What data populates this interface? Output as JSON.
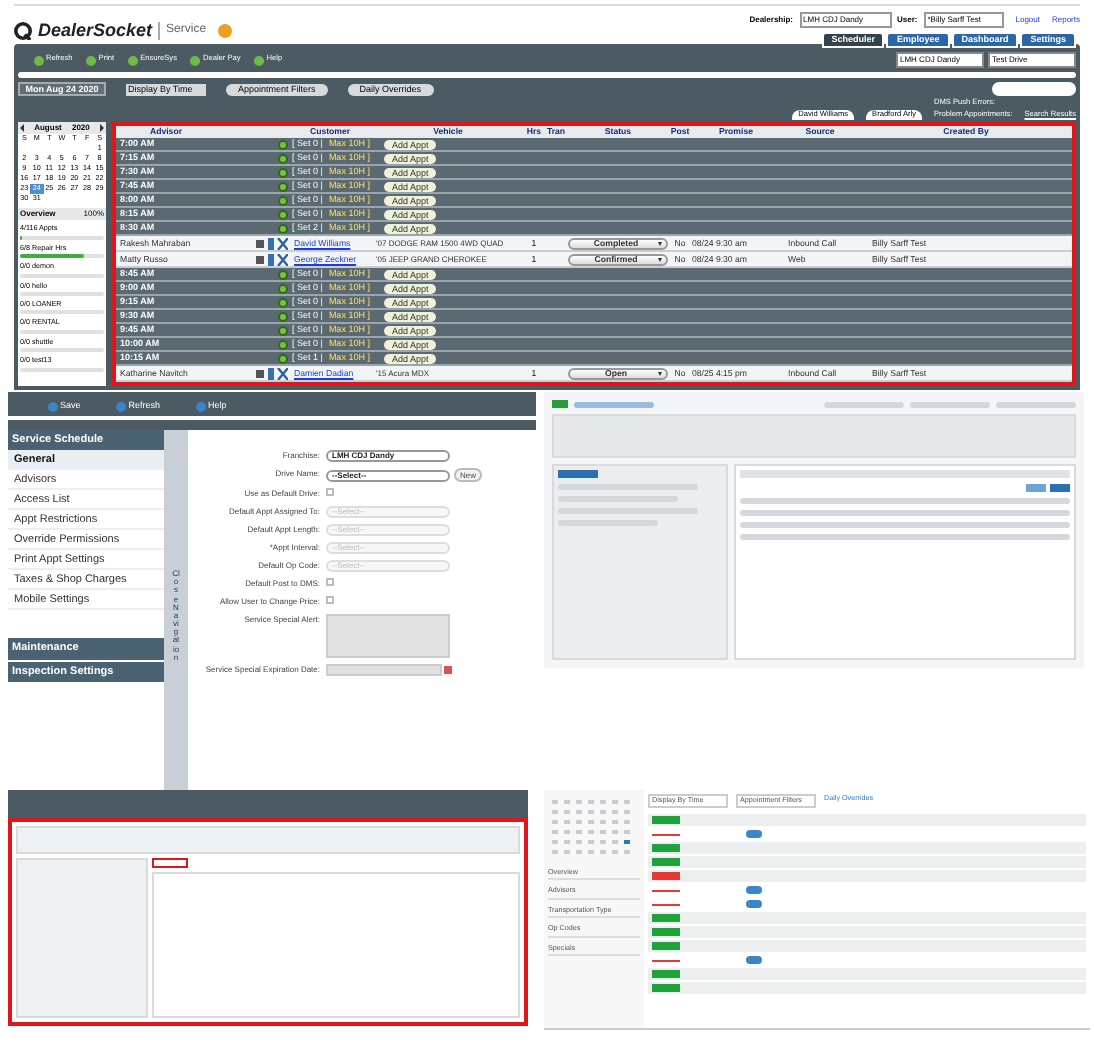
{
  "top": {
    "brand": "DealerSocket",
    "product": "Service",
    "dealership_label": "Dealership:",
    "dealership": "LMH CDJ Dandy",
    "user_label": "User:",
    "user": "*Billy Sarff Test",
    "links": [
      "Logout",
      "Reports"
    ],
    "tabs": [
      {
        "label": "Scheduler",
        "selected": true
      },
      {
        "label": "Employee",
        "selected": false
      },
      {
        "label": "Dashboard",
        "selected": false
      },
      {
        "label": "Settings",
        "selected": false
      }
    ],
    "filters": [
      "LMH CDJ Dandy",
      "Test Drive"
    ],
    "toolbar": [
      "Refresh",
      "Print",
      "EnsureSys",
      "Dealer Pay",
      "Help"
    ],
    "date": "Mon Aug 24 2020",
    "display": "Display By Time",
    "buttons": [
      "Appointment Filters",
      "Daily Overrides"
    ],
    "advisor_tabs": [
      "David Williams",
      "Bradford Arly"
    ],
    "counts": [
      "DMS Push Errors:",
      "Problem Appointments:"
    ],
    "search_results": "Search Results",
    "calendar": {
      "month": "August",
      "year": "2020",
      "weekdays": [
        "S",
        "M",
        "T",
        "W",
        "T",
        "F",
        "S"
      ],
      "weeks": [
        [
          {
            "d": "1",
            "selected": false
          }
        ],
        [
          {
            "d": "2",
            "selected": false
          },
          {
            "d": "3",
            "selected": false
          },
          {
            "d": "4",
            "selected": false
          },
          {
            "d": "5",
            "selected": false
          },
          {
            "d": "6",
            "selected": false
          },
          {
            "d": "7",
            "selected": false
          },
          {
            "d": "8",
            "selected": false
          }
        ],
        [
          {
            "d": "9",
            "selected": false
          },
          {
            "d": "10",
            "selected": false
          },
          {
            "d": "11",
            "selected": false
          },
          {
            "d": "12",
            "selected": false
          },
          {
            "d": "13",
            "selected": false
          },
          {
            "d": "14",
            "selected": false
          },
          {
            "d": "15",
            "selected": false
          }
        ],
        [
          {
            "d": "16",
            "selected": false
          },
          {
            "d": "17",
            "selected": false
          },
          {
            "d": "18",
            "selected": false
          },
          {
            "d": "19",
            "selected": false
          },
          {
            "d": "20",
            "selected": false
          },
          {
            "d": "21",
            "selected": false
          },
          {
            "d": "22",
            "selected": false
          }
        ],
        [
          {
            "d": "23",
            "selected": false
          },
          {
            "d": "24",
            "selected": true
          },
          {
            "d": "25",
            "selected": false
          },
          {
            "d": "26",
            "selected": false
          },
          {
            "d": "27",
            "selected": false
          },
          {
            "d": "28",
            "selected": false
          },
          {
            "d": "29",
            "selected": false
          }
        ],
        [
          {
            "d": "30",
            "selected": false
          },
          {
            "d": "31",
            "selected": false
          }
        ]
      ]
    },
    "overview_title": "Overview",
    "overview_pct": "100%",
    "overview": [
      {
        "label": "4/116 Appts",
        "level": 0.03
      },
      {
        "label": "6/8 Repair Hrs",
        "level": 0.75
      },
      {
        "label": "0/0 demon",
        "level": 0
      },
      {
        "label": "0/0 hello",
        "level": 0
      },
      {
        "label": "0/0 LOANER",
        "level": 0
      },
      {
        "label": "0/0 RENTAL",
        "level": 0
      },
      {
        "label": "0/0 shuttle",
        "level": 0
      },
      {
        "label": "0/0 test13",
        "level": 0
      }
    ],
    "columns": [
      "Advisor",
      "",
      "Customer",
      "Vehicle",
      "Hrs",
      "Tran",
      "Status",
      "Post",
      "Promise",
      "Source",
      "Created By"
    ],
    "rows": [
      {
        "kind": "slot",
        "time": "7:00 AM",
        "capacity": "[ Set 0 |",
        "max": "Max 10H ]",
        "add": "Add Appt"
      },
      {
        "kind": "slot",
        "time": "7:15 AM",
        "capacity": "[ Set 0 |",
        "max": "Max 10H ]",
        "add": "Add Appt"
      },
      {
        "kind": "slot",
        "time": "7:30 AM",
        "capacity": "[ Set 0 |",
        "max": "Max 10H ]",
        "add": "Add Appt"
      },
      {
        "kind": "slot",
        "time": "7:45 AM",
        "capacity": "[ Set 0 |",
        "max": "Max 10H ]",
        "add": "Add Appt"
      },
      {
        "kind": "slot",
        "time": "8:00 AM",
        "capacity": "[ Set 0 |",
        "max": "Max 10H ]",
        "add": "Add Appt"
      },
      {
        "kind": "slot",
        "time": "8:15 AM",
        "capacity": "[ Set 0 |",
        "max": "Max 10H ]",
        "add": "Add Appt"
      },
      {
        "kind": "slot",
        "time": "8:30 AM",
        "capacity": "[ Set 2 |",
        "max": "Max 10H ]",
        "add": "Add Appt"
      },
      {
        "kind": "appt",
        "advisor": "Rakesh Mahraban",
        "customer": "David Williams",
        "vehicle": "'07 DODGE RAM 1500 4WD QUAD",
        "hrs": "1",
        "status": "Completed",
        "post": "No",
        "promise": "08/24 9:30 am",
        "source": "Inbound Call",
        "created": "Billy Sarff Test"
      },
      {
        "kind": "appt",
        "advisor": "Matty Russo",
        "customer": "George Zeckner",
        "vehicle": "'05 JEEP GRAND CHEROKEE",
        "hrs": "1",
        "status": "Confirmed",
        "post": "No",
        "promise": "08/24 9:30 am",
        "source": "Web",
        "created": "Billy Sarff Test"
      },
      {
        "kind": "slot",
        "time": "8:45 AM",
        "capacity": "[ Set 0 |",
        "max": "Max 10H ]",
        "add": "Add Appt"
      },
      {
        "kind": "slot",
        "time": "9:00 AM",
        "capacity": "[ Set 0 |",
        "max": "Max 10H ]",
        "add": "Add Appt"
      },
      {
        "kind": "slot",
        "time": "9:15 AM",
        "capacity": "[ Set 0 |",
        "max": "Max 10H ]",
        "add": "Add Appt"
      },
      {
        "kind": "slot",
        "time": "9:30 AM",
        "capacity": "[ Set 0 |",
        "max": "Max 10H ]",
        "add": "Add Appt"
      },
      {
        "kind": "slot",
        "time": "9:45 AM",
        "capacity": "[ Set 0 |",
        "max": "Max 10H ]",
        "add": "Add Appt"
      },
      {
        "kind": "slot",
        "time": "10:00 AM",
        "capacity": "[ Set 0 |",
        "max": "Max 10H ]",
        "add": "Add Appt"
      },
      {
        "kind": "slot",
        "time": "10:15 AM",
        "capacity": "[ Set 1 |",
        "max": "Max 10H ]",
        "add": "Add Appt"
      },
      {
        "kind": "appt",
        "advisor": "Katharine Navitch",
        "customer": "Damien Dadian",
        "vehicle": "'15 Acura MDX",
        "hrs": "1",
        "status": "Open",
        "post": "No",
        "promise": "08/25 4:15 pm",
        "source": "Inbound Call",
        "created": "Billy Sarff Test"
      }
    ]
  },
  "settings": {
    "toolbar": [
      "Save",
      "Refresh",
      "Help"
    ],
    "section": "Service Schedule",
    "items": [
      {
        "label": "General",
        "selected": true
      },
      {
        "label": "Advisors",
        "selected": false
      },
      {
        "label": "Access List",
        "selected": false
      },
      {
        "label": "Appt Restrictions",
        "selected": false
      },
      {
        "label": "Override Permissions",
        "selected": false
      },
      {
        "label": "Print Appt Settings",
        "selected": false
      },
      {
        "label": "Taxes & Shop Charges",
        "selected": false
      },
      {
        "label": "Mobile Settings",
        "selected": false
      }
    ],
    "sections": [
      "Maintenance",
      "Inspection Settings"
    ],
    "close_nav": "Close Navigation",
    "fields": [
      {
        "kind": "select",
        "label": "Franchise:",
        "value": "LMH CDJ Dandy",
        "disabled": false
      },
      {
        "kind": "select",
        "label": "Drive Name:",
        "value": "--Select--",
        "disabled": false,
        "action": "New"
      },
      {
        "kind": "check",
        "label": "Use as Default Drive:",
        "checked": false
      },
      {
        "kind": "select",
        "label": "Default Appt Assigned To:",
        "value": "--Select--",
        "disabled": true
      },
      {
        "kind": "select",
        "label": "Default Appt Length:",
        "value": "--Select--",
        "disabled": true
      },
      {
        "kind": "select",
        "label": "*Appt Interval:",
        "value": "--Select--",
        "disabled": true
      },
      {
        "kind": "select",
        "label": "Default Op Code:",
        "value": "--Select--",
        "disabled": true
      },
      {
        "kind": "check",
        "label": "Default Post to DMS:",
        "checked": false
      },
      {
        "kind": "check",
        "label": "Allow User to Change Price:",
        "checked": false
      },
      {
        "kind": "textarea",
        "label": "Service Special Alert:"
      },
      {
        "kind": "date",
        "label": "Service Special Expiration Date:"
      }
    ]
  },
  "scheduler2": {
    "display": "Display By Time",
    "filters": "Appointment Filters",
    "overrides": "Daily Overrides",
    "sidebar": [
      "Overview",
      "Advisors",
      "Transportation Type",
      "Op Codes",
      "Specials"
    ],
    "rows": [
      {
        "kind": "slot",
        "color": "#1fa33a"
      },
      {
        "kind": "appt",
        "color": "#e53935"
      },
      {
        "kind": "slot",
        "color": "#1fa33a"
      },
      {
        "kind": "slot",
        "color": "#1fa33a"
      },
      {
        "kind": "slot",
        "color": "#e53935"
      },
      {
        "kind": "appt",
        "color": "#e53935"
      },
      {
        "kind": "appt",
        "color": "#e53935"
      },
      {
        "kind": "slot",
        "color": "#1fa33a"
      },
      {
        "kind": "slot",
        "color": "#1fa33a"
      },
      {
        "kind": "slot",
        "color": "#1fa33a"
      },
      {
        "kind": "appt",
        "color": "#e53935"
      },
      {
        "kind": "slot",
        "color": "#1fa33a"
      },
      {
        "kind": "slot",
        "color": "#1fa33a"
      }
    ]
  }
}
